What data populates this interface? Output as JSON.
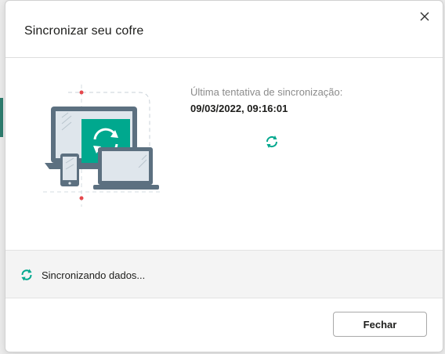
{
  "dialog": {
    "title": "Sincronizar seu cofre",
    "close_icon": "close-icon"
  },
  "sync": {
    "last_attempt_label": "Última tentativa de sincronização:",
    "last_attempt_value": "09/03/2022, 09:16:01",
    "spinner_icon": "sync-spinner-icon",
    "illustration": "devices-sync-illustration"
  },
  "status": {
    "icon": "sync-icon",
    "text": "Sincronizando dados..."
  },
  "footer": {
    "close_label": "Fechar"
  },
  "colors": {
    "accent": "#00a88e",
    "device_frame": "#5c7080",
    "device_light": "#dfe6ec",
    "marker_red": "#e5484d"
  }
}
